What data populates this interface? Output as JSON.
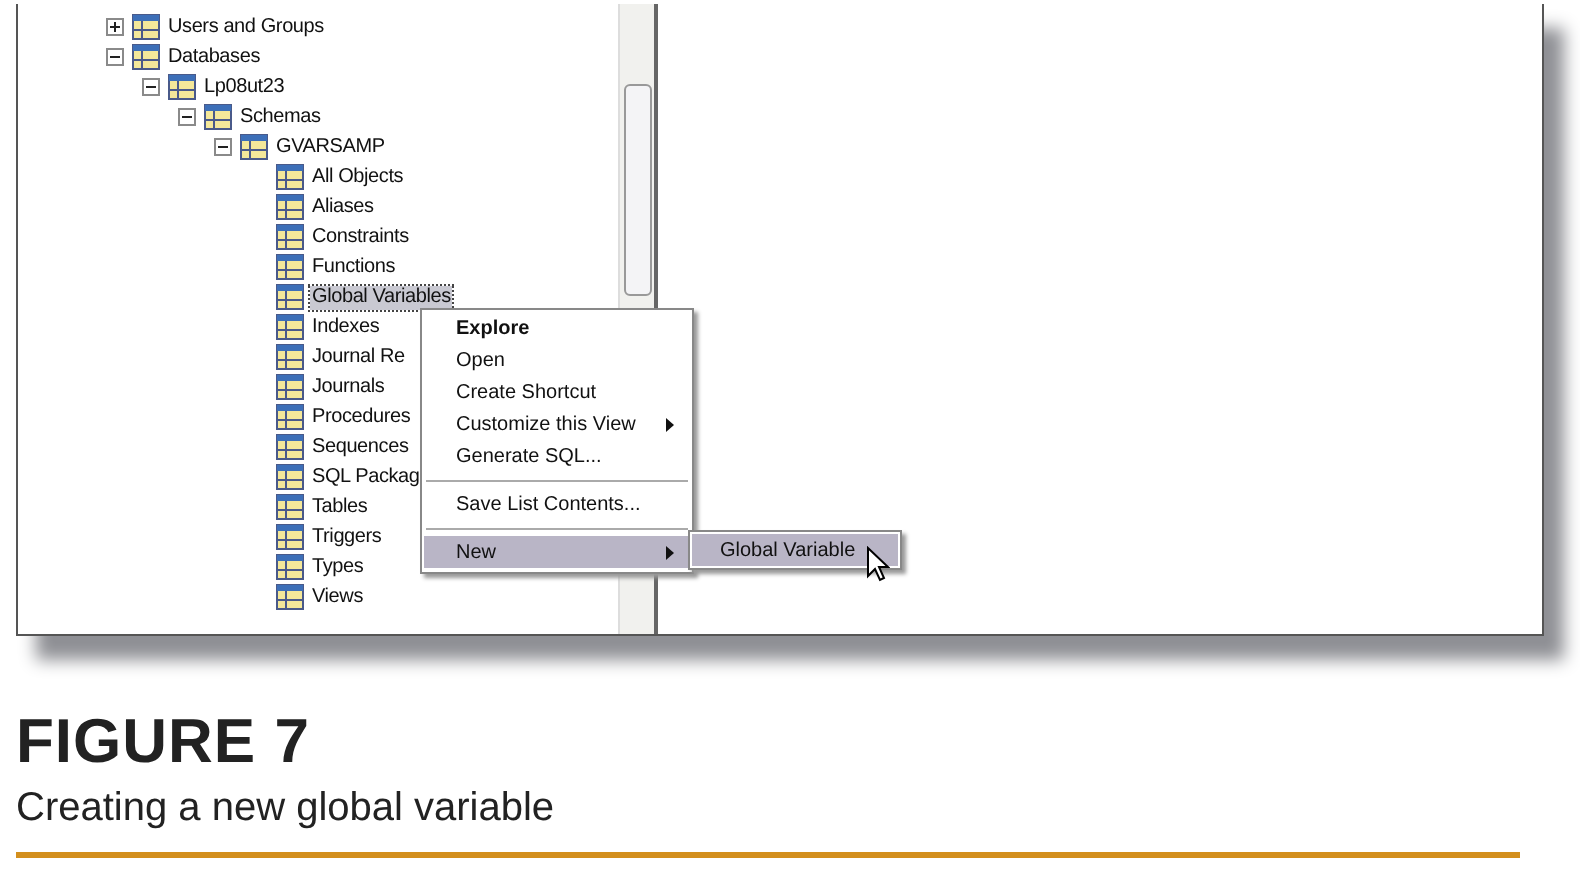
{
  "tree": {
    "items": [
      {
        "label": "Users and Groups",
        "expanded": false,
        "selected": false
      },
      {
        "label": "Databases",
        "expanded": true,
        "selected": false,
        "children": [
          {
            "label": "Lp08ut23",
            "expanded": true,
            "selected": false,
            "children": [
              {
                "label": "Schemas",
                "expanded": true,
                "selected": false,
                "children": [
                  {
                    "label": "GVARSAMP",
                    "expanded": true,
                    "selected": false,
                    "children": [
                      {
                        "label": "All Objects",
                        "selected": false
                      },
                      {
                        "label": "Aliases",
                        "selected": false
                      },
                      {
                        "label": "Constraints",
                        "selected": false
                      },
                      {
                        "label": "Functions",
                        "selected": false
                      },
                      {
                        "label": "Global Variables",
                        "selected": true
                      },
                      {
                        "label": "Indexes",
                        "selected": false
                      },
                      {
                        "label": "Journal Re",
                        "selected": false
                      },
                      {
                        "label": "Journals",
                        "selected": false
                      },
                      {
                        "label": "Procedures",
                        "selected": false
                      },
                      {
                        "label": "Sequences",
                        "selected": false
                      },
                      {
                        "label": "SQL Packag",
                        "selected": false
                      },
                      {
                        "label": "Tables",
                        "selected": false
                      },
                      {
                        "label": "Triggers",
                        "selected": false
                      },
                      {
                        "label": "Types",
                        "selected": false
                      },
                      {
                        "label": "Views",
                        "selected": false
                      }
                    ]
                  }
                ]
              }
            ]
          }
        ]
      }
    ]
  },
  "context_menu": {
    "items": [
      {
        "kind": "item",
        "label": "Explore",
        "default": true,
        "selected": false,
        "submenu": false
      },
      {
        "kind": "item",
        "label": "Open",
        "default": false,
        "selected": false,
        "submenu": false
      },
      {
        "kind": "item",
        "label": "Create Shortcut",
        "default": false,
        "selected": false,
        "submenu": false
      },
      {
        "kind": "item",
        "label": "Customize this View",
        "default": false,
        "selected": false,
        "submenu": true
      },
      {
        "kind": "item",
        "label": "Generate SQL...",
        "default": false,
        "selected": false,
        "submenu": false
      },
      {
        "kind": "separator"
      },
      {
        "kind": "item",
        "label": "Save List Contents...",
        "default": false,
        "selected": false,
        "submenu": false
      },
      {
        "kind": "separator"
      },
      {
        "kind": "item",
        "label": "New",
        "default": false,
        "selected": true,
        "submenu": true
      }
    ]
  },
  "submenu": {
    "items": [
      {
        "label": "Global Variable",
        "selected": true
      }
    ]
  },
  "figure": {
    "label": "FIGURE 7",
    "caption": "Creating a new global variable"
  }
}
